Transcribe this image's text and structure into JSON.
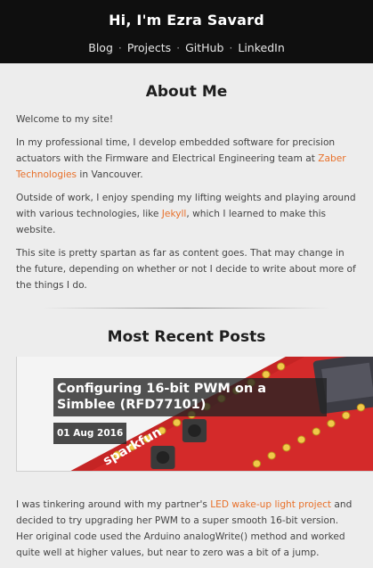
{
  "header": {
    "title": "Hi, I'm Ezra Savard",
    "nav": [
      "Blog",
      "Projects",
      "GitHub",
      "LinkedIn"
    ],
    "separator": "·"
  },
  "about": {
    "heading": "About Me",
    "p1": "Welcome to my site!",
    "p2_before": "In my professional time, I develop embedded software for precision actuators with the Firmware and Electrical Engineering team at ",
    "p2_link": "Zaber Technologies",
    "p2_after": " in Vancouver.",
    "p3_before": "Outside of work, I enjoy spending my lifting weights and playing around with various technologies, like ",
    "p3_link": "Jekyll",
    "p3_after": ", which I learned to make this website.",
    "p4": "This site is pretty spartan as far as content goes. That may change in the future, depending on whether or not I decide to write about more of the things I do."
  },
  "recent": {
    "heading": "Most Recent Posts",
    "posts": [
      {
        "title": "Configuring 16-bit PWM on a Simblee (RFD77101)",
        "date": "01 Aug 2016",
        "image_brand_text": "sparkfun",
        "excerpt_before": "I was tinkering around with my partner's ",
        "excerpt_link": "LED wake-up light project",
        "excerpt_after": " and decided to try upgrading her PWM to a super smooth 16-bit version. Her original code used the Arduino analogWrite() method and worked quite well at higher values, but near to zero was a bit of a jump."
      }
    ]
  },
  "colors": {
    "link": "#e8702a",
    "header_bg": "#0f0f0f",
    "page_bg": "#ededed",
    "board_red": "#d42a2a"
  }
}
